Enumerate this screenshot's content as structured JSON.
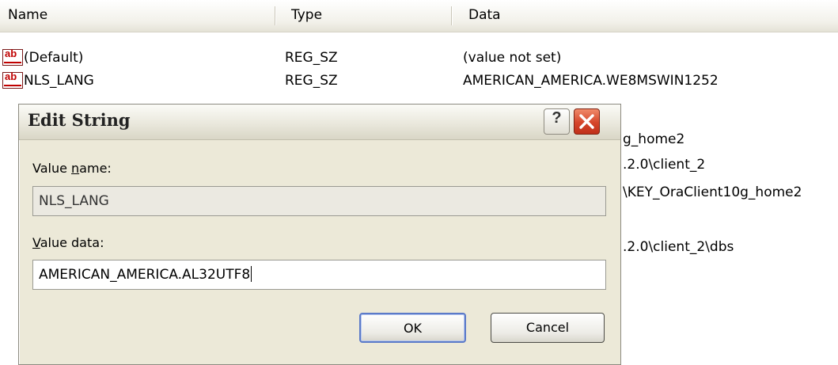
{
  "listview": {
    "columns": [
      "Name",
      "Type",
      "Data"
    ],
    "rows": [
      {
        "name": "(Default)",
        "type": "REG_SZ",
        "data": "(value not set)",
        "icon": "registry-string-icon"
      },
      {
        "name": "NLS_LANG",
        "type": "REG_SZ",
        "data": "AMERICAN_AMERICA.WE8MSWIN1252",
        "icon": "registry-string-icon"
      }
    ],
    "partial_data": [
      "g_home2",
      ".2.0\\client_2",
      "\\KEY_OraClient10g_home2",
      ".2.0\\client_2\\dbs"
    ]
  },
  "dialog": {
    "title": "Edit String",
    "help_label": "?",
    "value_name_label_pre": "Value ",
    "value_name_label_key": "n",
    "value_name_label_post": "ame:",
    "value_name": "NLS_LANG",
    "value_data_label_key": "V",
    "value_data_label_post": "alue data:",
    "value_data": "AMERICAN_AMERICA.AL32UTF8",
    "ok_label": "OK",
    "cancel_label": "Cancel"
  },
  "colors": {
    "close_button": "#d5452a",
    "ok_focus_border": "#5b7ac8",
    "dialog_bg": "#ece9d8"
  }
}
